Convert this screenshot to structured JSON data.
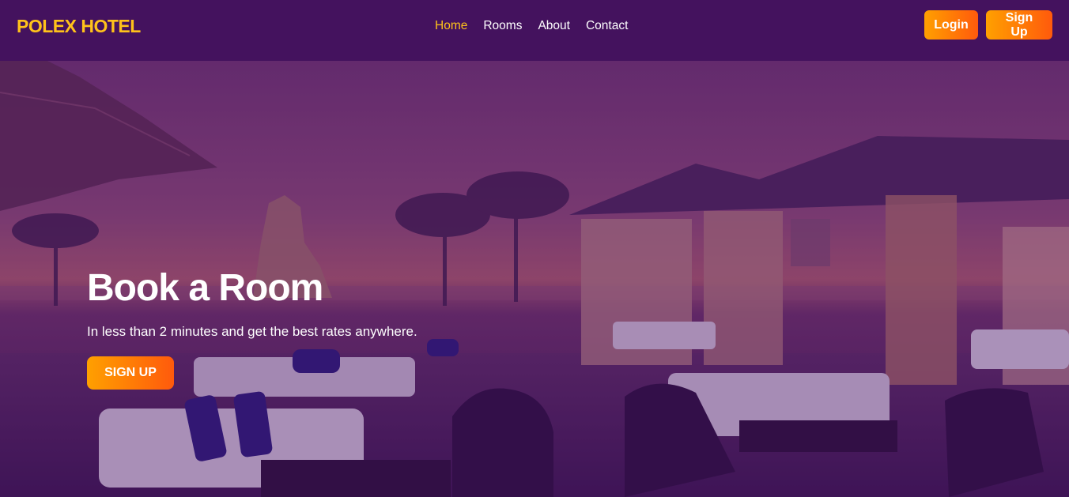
{
  "brand": "POLEX HOTEL",
  "nav": {
    "links": [
      {
        "label": "Home",
        "active": true
      },
      {
        "label": "Rooms",
        "active": false
      },
      {
        "label": "About",
        "active": false
      },
      {
        "label": "Contact",
        "active": false
      }
    ]
  },
  "auth": {
    "login_label": "Login",
    "signup_label": "Sign Up"
  },
  "hero": {
    "title": "Book a Room",
    "subtitle": "In less than 2 minutes and get the best rates anywhere.",
    "cta_label": "SIGN UP"
  },
  "colors": {
    "nav_bg": "#44125e",
    "brand": "#ffc21a",
    "accent_start": "#ffa000",
    "accent_end": "#ff5a0c",
    "active_link": "#ffc21a"
  }
}
